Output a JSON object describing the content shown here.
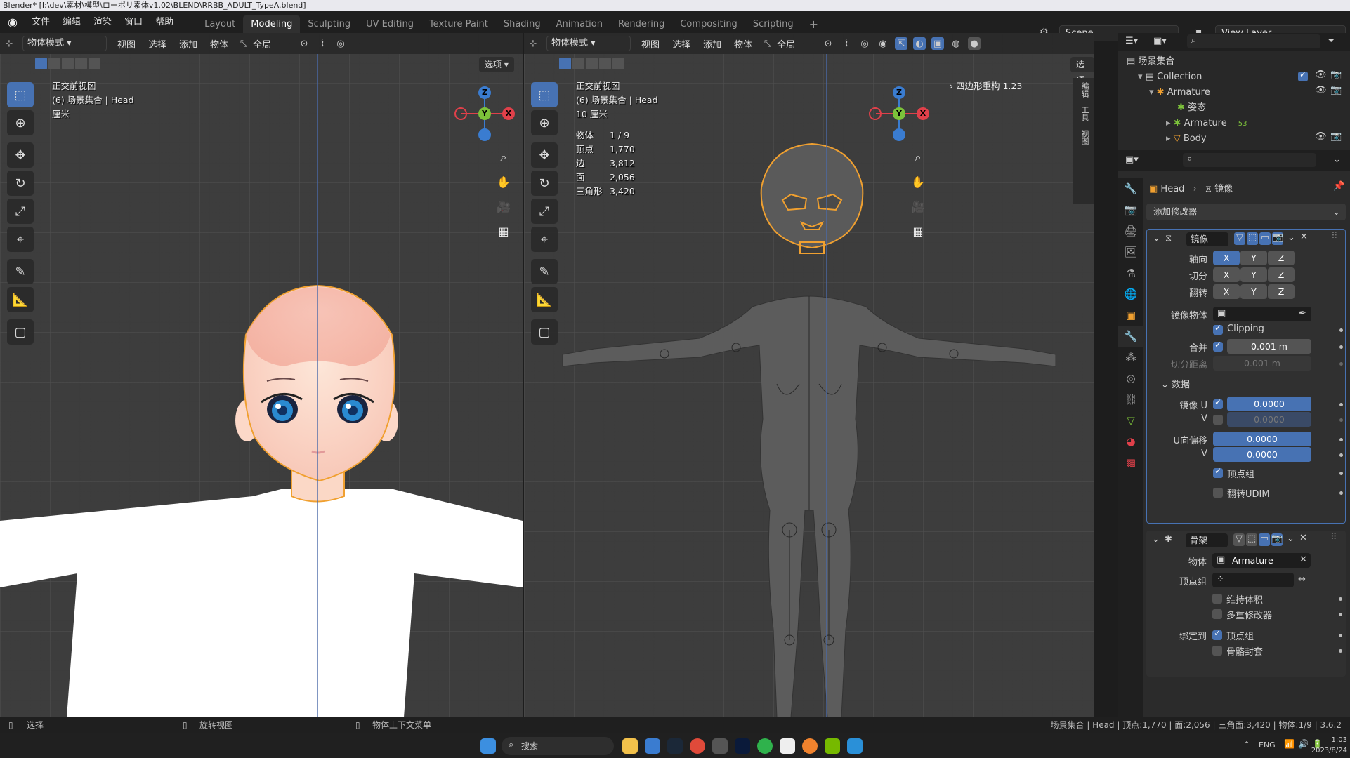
{
  "titlebar": {
    "text": "Blender* [I:\\dev\\素材\\模型\\ローポリ素体v1.02\\BLEND\\RRBB_ADULT_TypeA.blend]"
  },
  "topbar": {
    "menus": [
      "文件",
      "编辑",
      "渲染",
      "窗口",
      "帮助"
    ],
    "workspaces": [
      "Layout",
      "Modeling",
      "Sculpting",
      "UV Editing",
      "Texture Paint",
      "Shading",
      "Animation",
      "Rendering",
      "Compositing",
      "Scripting"
    ],
    "scene": "Scene",
    "view_layer": "View Layer"
  },
  "left_view": {
    "mode": "物体模式",
    "menus": [
      "视图",
      "选择",
      "添加",
      "物体"
    ],
    "transform": "全局",
    "options": "选项",
    "info": [
      "正交前视图",
      "(6) 场景集合 | Head",
      "厘米"
    ]
  },
  "right_view": {
    "mode": "物体模式",
    "menus": [
      "视图",
      "选择",
      "添加",
      "物体"
    ],
    "transform": "全局",
    "options": "选项",
    "info": [
      "正交前视图",
      "(6) 场景集合 | Head",
      "10 厘米"
    ],
    "stats": [
      {
        "k": "物体",
        "v": "1 / 9"
      },
      {
        "k": "顶点",
        "v": "1,770"
      },
      {
        "k": "边",
        "v": "3,812"
      },
      {
        "k": "面",
        "v": "2,056"
      },
      {
        "k": "三角形",
        "v": "3,420"
      }
    ],
    "addon": "四边形重构 1.23",
    "side_tabs": [
      "编辑",
      "工具",
      "视图"
    ]
  },
  "gizmo": {
    "z": "Z",
    "y": "Y",
    "x": "X"
  },
  "outliner": {
    "rows": [
      {
        "label": "场景集合"
      },
      {
        "label": "Collection"
      },
      {
        "label": "Armature"
      },
      {
        "label": "姿态"
      },
      {
        "label": "Armature",
        "badge": "53"
      },
      {
        "label": "Body"
      }
    ]
  },
  "properties": {
    "breadcrumb_obj": "Head",
    "breadcrumb_mod": "镜像",
    "add_modifier": "添加修改器",
    "mirror": {
      "name": "镜像",
      "axis_label": "轴向",
      "bisect_label": "切分",
      "flip_label": "翻转",
      "axes": [
        "X",
        "Y",
        "Z"
      ],
      "mirror_obj_label": "镜像物体",
      "clipping": "Clipping",
      "merge_label": "合并",
      "merge_value": "0.001 m",
      "bisect_dist_label": "切分距离",
      "bisect_dist_value": "0.001 m",
      "data_label": "数据",
      "mirror_u": "镜像 U",
      "u_val": "0.0000",
      "v_label": "V",
      "v_val": "0.0000",
      "u_offset": "U向偏移",
      "u_off_val": "0.0000",
      "v2_label": "V",
      "v_off_val": "0.0000",
      "vgroup": "顶点组",
      "flip_udim": "翻转UDIM"
    },
    "armature": {
      "name": "骨架",
      "object_label": "物体",
      "object_value": "Armature",
      "vgroup_label": "顶点组",
      "preserve": "维持体积",
      "multi": "多重修改器",
      "bind_label": "绑定到",
      "bind_vgroup": "顶点组",
      "bind_env": "骨骼封套"
    }
  },
  "statusbar": {
    "left": [
      "选择",
      "旋转视图",
      "物体上下文菜单"
    ],
    "right": "场景集合 | Head | 顶点:1,770 | 面:2,056 | 三角面:3,420 | 物体:1/9 | 3.6.2"
  },
  "taskbar": {
    "search": "搜索",
    "lang": "ENG",
    "time": "1:03",
    "date": "2023/8/24"
  },
  "colors": {
    "accent": "#4772b3",
    "selected_outline": "#f0a030",
    "x_axis": "#e0404a",
    "y_axis": "#7cc23a",
    "z_axis": "#3a7cd0"
  }
}
